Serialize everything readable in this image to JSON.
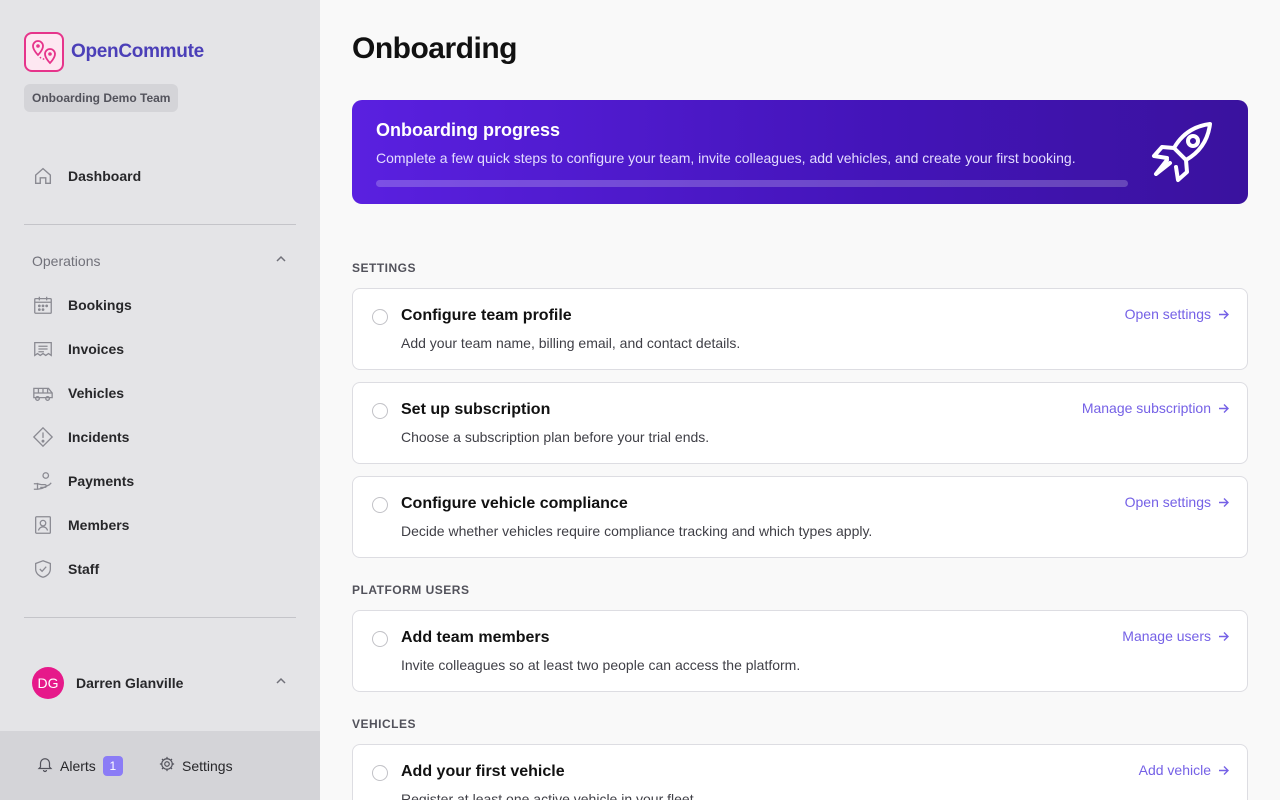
{
  "brand": {
    "name": "OpenCommute",
    "team": "Onboarding Demo Team"
  },
  "nav": {
    "dashboard": "Dashboard",
    "section_label": "Operations",
    "items": [
      {
        "label": "Bookings",
        "icon": "calendar-icon"
      },
      {
        "label": "Invoices",
        "icon": "invoice-icon"
      },
      {
        "label": "Vehicles",
        "icon": "bus-icon"
      },
      {
        "label": "Incidents",
        "icon": "warning-icon"
      },
      {
        "label": "Payments",
        "icon": "payment-hand-icon"
      },
      {
        "label": "Members",
        "icon": "member-card-icon"
      },
      {
        "label": "Staff",
        "icon": "shield-check-icon"
      }
    ]
  },
  "user": {
    "initials": "DG",
    "name": "Darren Glanville"
  },
  "footer": {
    "alerts_label": "Alerts",
    "alerts_count": "1",
    "settings_label": "Settings"
  },
  "page": {
    "title": "Onboarding"
  },
  "banner": {
    "title": "Onboarding progress",
    "description": "Complete a few quick steps to configure your team, invite colleagues, add vehicles, and create your first booking.",
    "progress_fraction": 0
  },
  "groups": [
    {
      "label": "SETTINGS",
      "tasks": [
        {
          "title": "Configure team profile",
          "description": "Add your team name, billing email, and contact details.",
          "link": "Open settings",
          "done": false
        },
        {
          "title": "Set up subscription",
          "description": "Choose a subscription plan before your trial ends.",
          "link": "Manage subscription",
          "done": false
        },
        {
          "title": "Configure vehicle compliance",
          "description": "Decide whether vehicles require compliance tracking and which types apply.",
          "link": "Open settings",
          "done": false
        }
      ]
    },
    {
      "label": "PLATFORM USERS",
      "tasks": [
        {
          "title": "Add team members",
          "description": "Invite colleagues so at least two people can access the platform.",
          "link": "Manage users",
          "done": false
        }
      ]
    },
    {
      "label": "VEHICLES",
      "tasks": [
        {
          "title": "Add your first vehicle",
          "description": "Register at least one active vehicle in your fleet.",
          "link": "Add vehicle",
          "done": false
        }
      ]
    }
  ],
  "colors": {
    "brand": "#4b3fb8",
    "accent": "#e6348b",
    "link": "#7561e6",
    "banner_start": "#5a20e0",
    "banner_end": "#3a129e",
    "avatar": "#e6198a"
  }
}
